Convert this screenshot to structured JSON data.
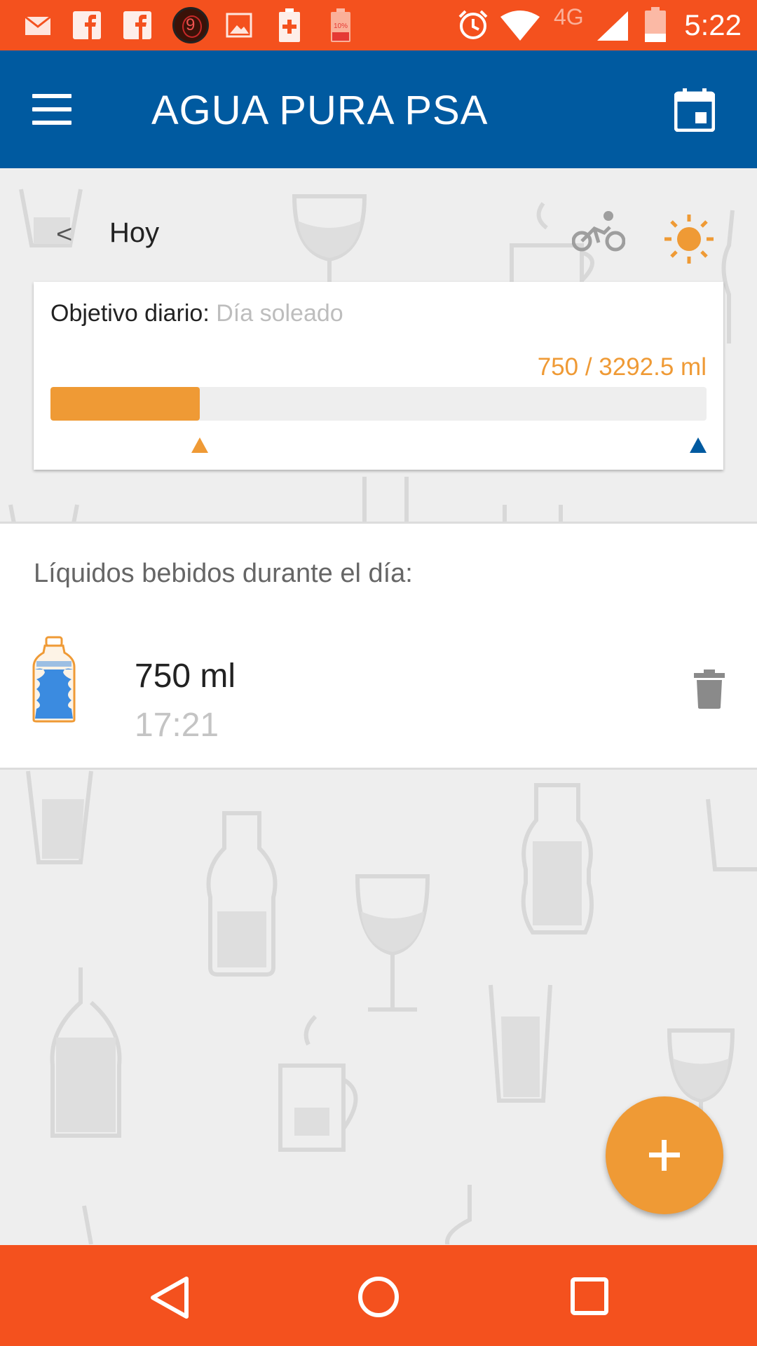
{
  "status_bar": {
    "time": "5:22",
    "notification_badge": "9",
    "network": "4G",
    "icons_left": [
      "email-icon",
      "facebook-icon",
      "facebook-icon",
      "badge-icon",
      "image-icon",
      "battery-plus-icon",
      "battery-low-icon"
    ],
    "icons_right": [
      "alarm-icon",
      "wifi-icon",
      "signal-icon",
      "battery-icon"
    ]
  },
  "app_bar": {
    "title": "AGUA PURA PSA",
    "menu_icon": "hamburger-menu-icon",
    "calendar_icon": "calendar-icon",
    "color": "#005aa0"
  },
  "day": {
    "back_label": "<",
    "label": "Hoy",
    "activity_icon": "bicycle-icon",
    "weather_icon": "sun-icon"
  },
  "goal": {
    "label": "Objetivo diario:",
    "value": "Día soleado",
    "amount_text": "750 / 3292.5 ml",
    "consumed_ml": 750,
    "goal_ml": 3292.5,
    "progress_fraction": 0.228,
    "accent": "#ef9a35"
  },
  "liquids": {
    "title": "Líquidos bebidos durante el día:",
    "entries": [
      {
        "amount": "750 ml",
        "time": "17:21",
        "icon": "water-bottle-icon"
      }
    ]
  },
  "fab": {
    "icon": "plus-icon"
  },
  "nav_bar": {
    "icons": [
      "back-triangle-icon",
      "home-circle-icon",
      "recents-square-icon"
    ]
  }
}
